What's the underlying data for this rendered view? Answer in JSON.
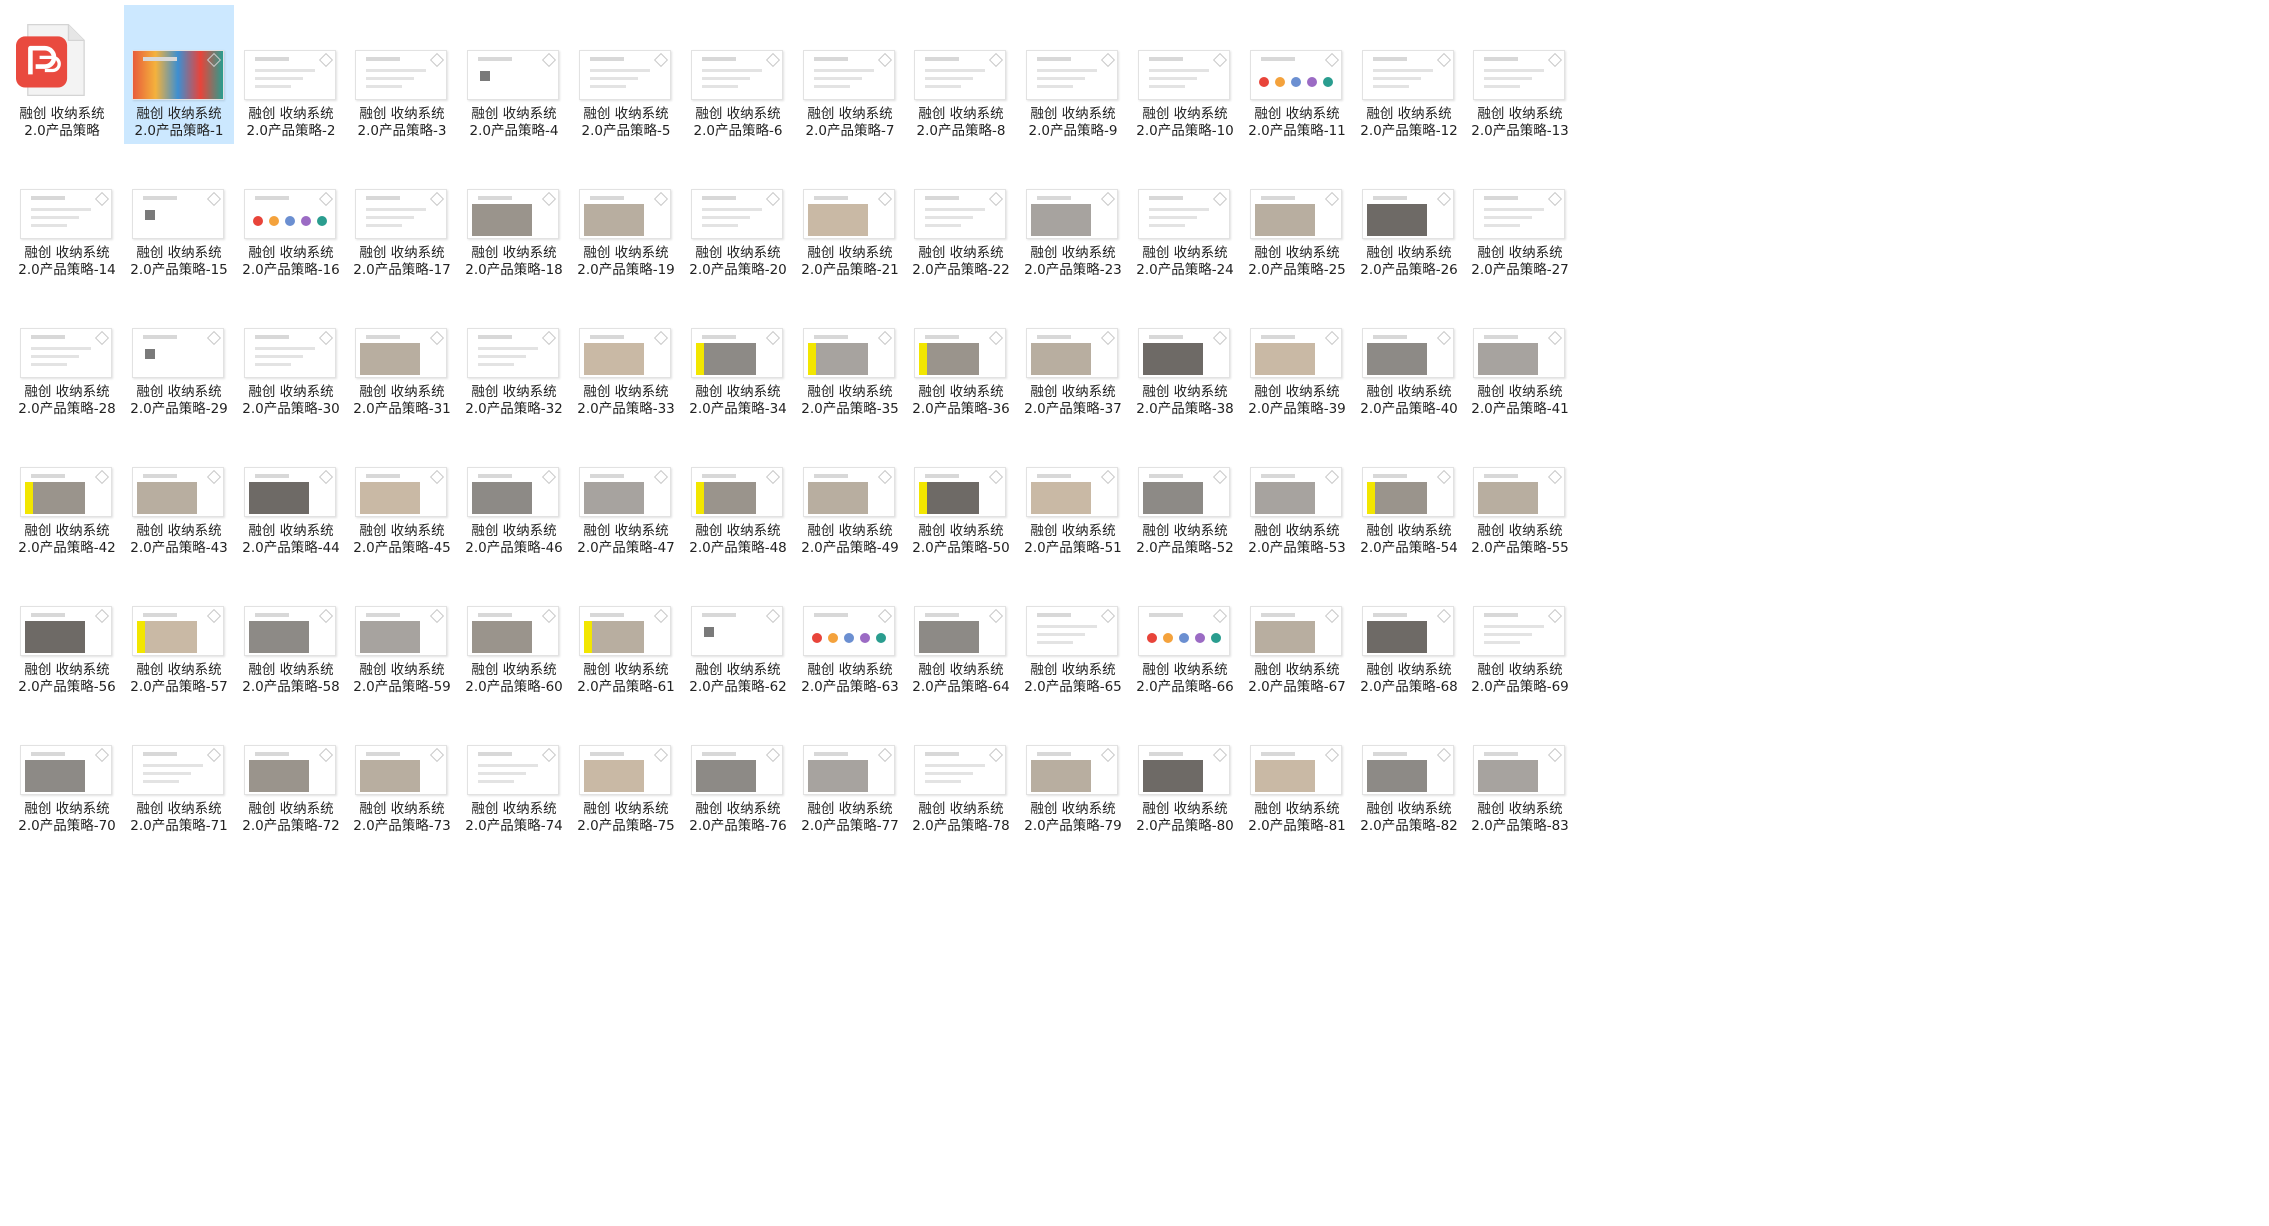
{
  "window": {
    "title": ""
  },
  "colors": {
    "selection": "#cce8ff",
    "text": "#222222",
    "pdf_red": "#e94a3f"
  },
  "folder_item": {
    "line1": "融创 收纳系统",
    "line2": "2.0产品策略",
    "icon": "pdf-icon"
  },
  "files": [
    {
      "line1": "融创 收纳系统",
      "line2": "2.0产品策略-1",
      "selected": true
    },
    {
      "line1": "融创 收纳系统",
      "line2": "2.0产品策略-2"
    },
    {
      "line1": "融创 收纳系统",
      "line2": "2.0产品策略-3"
    },
    {
      "line1": "融创 收纳系统",
      "line2": "2.0产品策略-4"
    },
    {
      "line1": "融创 收纳系统",
      "line2": "2.0产品策略-5"
    },
    {
      "line1": "融创 收纳系统",
      "line2": "2.0产品策略-6"
    },
    {
      "line1": "融创 收纳系统",
      "line2": "2.0产品策略-7"
    },
    {
      "line1": "融创 收纳系统",
      "line2": "2.0产品策略-8"
    },
    {
      "line1": "融创 收纳系统",
      "line2": "2.0产品策略-9"
    },
    {
      "line1": "融创 收纳系统",
      "line2": "2.0产品策略-10"
    },
    {
      "line1": "融创 收纳系统",
      "line2": "2.0产品策略-11"
    },
    {
      "line1": "融创 收纳系统",
      "line2": "2.0产品策略-12"
    },
    {
      "line1": "融创 收纳系统",
      "line2": "2.0产品策略-13"
    },
    {
      "line1": "融创 收纳系统",
      "line2": "2.0产品策略-14"
    },
    {
      "line1": "融创 收纳系统",
      "line2": "2.0产品策略-15"
    },
    {
      "line1": "融创 收纳系统",
      "line2": "2.0产品策略-16"
    },
    {
      "line1": "融创 收纳系统",
      "line2": "2.0产品策略-17"
    },
    {
      "line1": "融创 收纳系统",
      "line2": "2.0产品策略-18"
    },
    {
      "line1": "融创 收纳系统",
      "line2": "2.0产品策略-19"
    },
    {
      "line1": "融创 收纳系统",
      "line2": "2.0产品策略-20"
    },
    {
      "line1": "融创 收纳系统",
      "line2": "2.0产品策略-21"
    },
    {
      "line1": "融创 收纳系统",
      "line2": "2.0产品策略-22"
    },
    {
      "line1": "融创 收纳系统",
      "line2": "2.0产品策略-23"
    },
    {
      "line1": "融创 收纳系统",
      "line2": "2.0产品策略-24"
    },
    {
      "line1": "融创 收纳系统",
      "line2": "2.0产品策略-25"
    },
    {
      "line1": "融创 收纳系统",
      "line2": "2.0产品策略-26"
    },
    {
      "line1": "融创 收纳系统",
      "line2": "2.0产品策略-27"
    },
    {
      "line1": "融创 收纳系统",
      "line2": "2.0产品策略-28"
    },
    {
      "line1": "融创 收纳系统",
      "line2": "2.0产品策略-29"
    },
    {
      "line1": "融创 收纳系统",
      "line2": "2.0产品策略-30"
    },
    {
      "line1": "融创 收纳系统",
      "line2": "2.0产品策略-31"
    },
    {
      "line1": "融创 收纳系统",
      "line2": "2.0产品策略-32"
    },
    {
      "line1": "融创 收纳系统",
      "line2": "2.0产品策略-33"
    },
    {
      "line1": "融创 收纳系统",
      "line2": "2.0产品策略-34"
    },
    {
      "line1": "融创 收纳系统",
      "line2": "2.0产品策略-35"
    },
    {
      "line1": "融创 收纳系统",
      "line2": "2.0产品策略-36"
    },
    {
      "line1": "融创 收纳系统",
      "line2": "2.0产品策略-37"
    },
    {
      "line1": "融创 收纳系统",
      "line2": "2.0产品策略-38"
    },
    {
      "line1": "融创 收纳系统",
      "line2": "2.0产品策略-39"
    },
    {
      "line1": "融创 收纳系统",
      "line2": "2.0产品策略-40"
    },
    {
      "line1": "融创 收纳系统",
      "line2": "2.0产品策略-41"
    },
    {
      "line1": "融创 收纳系统",
      "line2": "2.0产品策略-42"
    },
    {
      "line1": "融创 收纳系统",
      "line2": "2.0产品策略-43"
    },
    {
      "line1": "融创 收纳系统",
      "line2": "2.0产品策略-44"
    },
    {
      "line1": "融创 收纳系统",
      "line2": "2.0产品策略-45"
    },
    {
      "line1": "融创 收纳系统",
      "line2": "2.0产品策略-46"
    },
    {
      "line1": "融创 收纳系统",
      "line2": "2.0产品策略-47"
    },
    {
      "line1": "融创 收纳系统",
      "line2": "2.0产品策略-48"
    },
    {
      "line1": "融创 收纳系统",
      "line2": "2.0产品策略-49"
    },
    {
      "line1": "融创 收纳系统",
      "line2": "2.0产品策略-50"
    },
    {
      "line1": "融创 收纳系统",
      "line2": "2.0产品策略-51"
    },
    {
      "line1": "融创 收纳系统",
      "line2": "2.0产品策略-52"
    },
    {
      "line1": "融创 收纳系统",
      "line2": "2.0产品策略-53"
    },
    {
      "line1": "融创 收纳系统",
      "line2": "2.0产品策略-54"
    },
    {
      "line1": "融创 收纳系统",
      "line2": "2.0产品策略-55"
    },
    {
      "line1": "融创 收纳系统",
      "line2": "2.0产品策略-56"
    },
    {
      "line1": "融创 收纳系统",
      "line2": "2.0产品策略-57"
    },
    {
      "line1": "融创 收纳系统",
      "line2": "2.0产品策略-58"
    },
    {
      "line1": "融创 收纳系统",
      "line2": "2.0产品策略-59"
    },
    {
      "line1": "融创 收纳系统",
      "line2": "2.0产品策略-60"
    },
    {
      "line1": "融创 收纳系统",
      "line2": "2.0产品策略-61"
    },
    {
      "line1": "融创 收纳系统",
      "line2": "2.0产品策略-62"
    },
    {
      "line1": "融创 收纳系统",
      "line2": "2.0产品策略-63"
    },
    {
      "line1": "融创 收纳系统",
      "line2": "2.0产品策略-64"
    },
    {
      "line1": "融创 收纳系统",
      "line2": "2.0产品策略-65"
    },
    {
      "line1": "融创 收纳系统",
      "line2": "2.0产品策略-66"
    },
    {
      "line1": "融创 收纳系统",
      "line2": "2.0产品策略-67"
    },
    {
      "line1": "融创 收纳系统",
      "line2": "2.0产品策略-68"
    },
    {
      "line1": "融创 收纳系统",
      "line2": "2.0产品策略-69"
    },
    {
      "line1": "融创 收纳系统",
      "line2": "2.0产品策略-70"
    },
    {
      "line1": "融创 收纳系统",
      "line2": "2.0产品策略-71"
    },
    {
      "line1": "融创 收纳系统",
      "line2": "2.0产品策略-72"
    },
    {
      "line1": "融创 收纳系统",
      "line2": "2.0产品策略-73"
    },
    {
      "line1": "融创 收纳系统",
      "line2": "2.0产品策略-74"
    },
    {
      "line1": "融创 收纳系统",
      "line2": "2.0产品策略-75"
    },
    {
      "line1": "融创 收纳系统",
      "line2": "2.0产品策略-76"
    },
    {
      "line1": "融创 收纳系统",
      "line2": "2.0产品策略-77"
    },
    {
      "line1": "融创 收纳系统",
      "line2": "2.0产品策略-78"
    },
    {
      "line1": "融创 收纳系统",
      "line2": "2.0产品策略-79"
    },
    {
      "line1": "融创 收纳系统",
      "line2": "2.0产品策略-80"
    },
    {
      "line1": "融创 收纳系统",
      "line2": "2.0产品策略-81"
    },
    {
      "line1": "融创 收纳系统",
      "line2": "2.0产品策略-82"
    },
    {
      "line1": "融创 收纳系统",
      "line2": "2.0产品策略-83"
    }
  ]
}
